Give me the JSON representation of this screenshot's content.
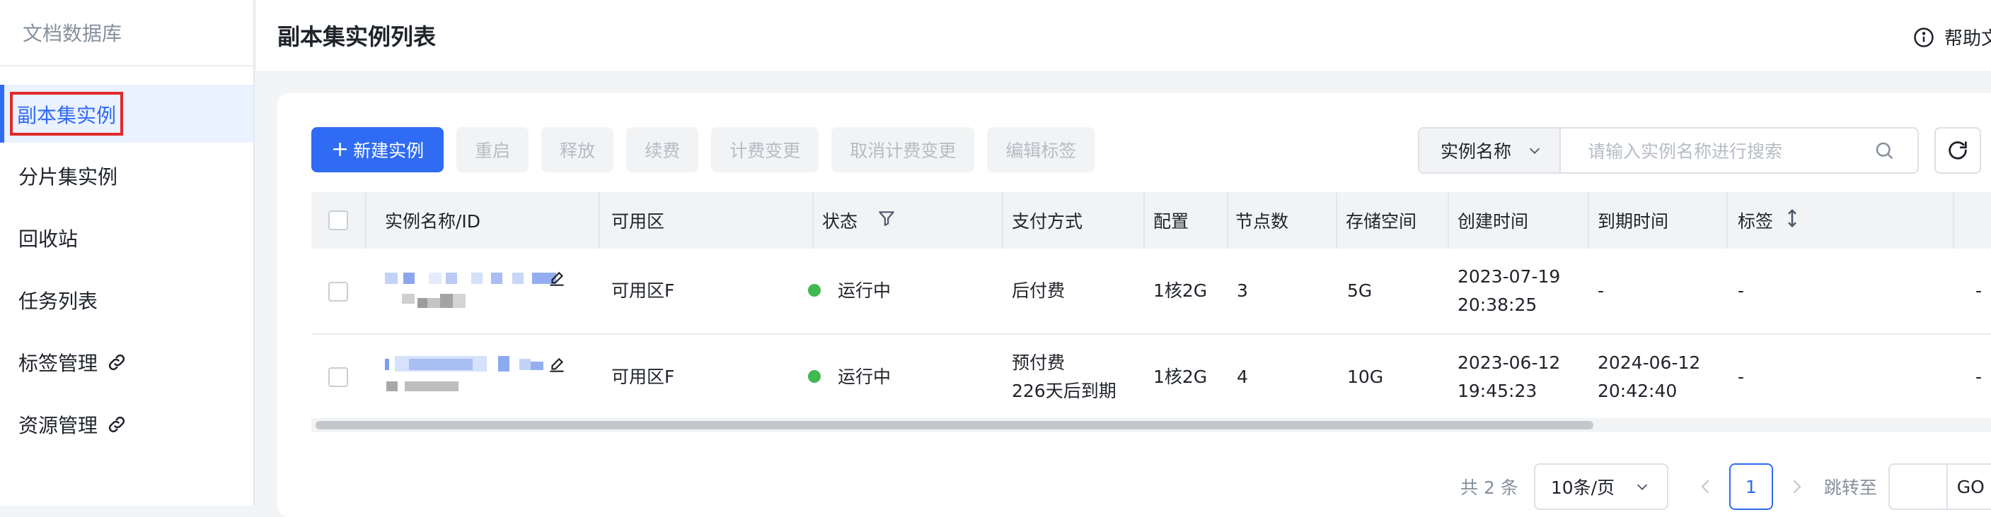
{
  "sidebar": {
    "title": "文档数据库",
    "items": [
      {
        "label": "副本集实例",
        "active": true
      },
      {
        "label": "分片集实例"
      },
      {
        "label": "回收站"
      },
      {
        "label": "任务列表"
      },
      {
        "label": "标签管理",
        "icon": "link-icon"
      },
      {
        "label": "资源管理",
        "icon": "link-icon"
      }
    ]
  },
  "header": {
    "title": "副本集实例列表",
    "help_label": "帮助文档",
    "help_icon": "info-icon"
  },
  "toolbar": {
    "create_label": "新建实例",
    "restart_label": "重启",
    "release_label": "释放",
    "renew_label": "续费",
    "billing_change_label": "计费变更",
    "cancel_billing_change_label": "取消计费变更",
    "edit_tags_label": "编辑标签"
  },
  "search": {
    "field_label": "实例名称",
    "placeholder": "请输入实例名称进行搜索"
  },
  "table": {
    "columns": [
      "实例名称/ID",
      "可用区",
      "状态",
      "支付方式",
      "配置",
      "节点数",
      "存储空间",
      "创建时间",
      "到期时间",
      "标签"
    ],
    "rows": [
      {
        "zone": "可用区F",
        "status": "运行中",
        "payment_line1": "后付费",
        "payment_line2": "",
        "config": "1核2G",
        "nodes": "3",
        "storage": "5G",
        "created_date": "2023-07-19",
        "created_time": "20:38:25",
        "expire_date": "-",
        "expire_time": "",
        "tags": "-",
        "extra": "-"
      },
      {
        "zone": "可用区F",
        "status": "运行中",
        "payment_line1": "预付费",
        "payment_line2": "226天后到期",
        "config": "1核2G",
        "nodes": "4",
        "storage": "10G",
        "created_date": "2023-06-12",
        "created_time": "19:45:23",
        "expire_date": "2024-06-12",
        "expire_time": "20:42:40",
        "tags": "-",
        "extra": "-"
      }
    ]
  },
  "pagination": {
    "total": "共 2 条",
    "page_size": "10条/页",
    "current_page": "1",
    "jump_label": "跳转至",
    "go_label": "GO"
  },
  "colors": {
    "accent": "#2f6bf3",
    "running": "#3fb950",
    "highlight_box": "#e02a2a"
  }
}
